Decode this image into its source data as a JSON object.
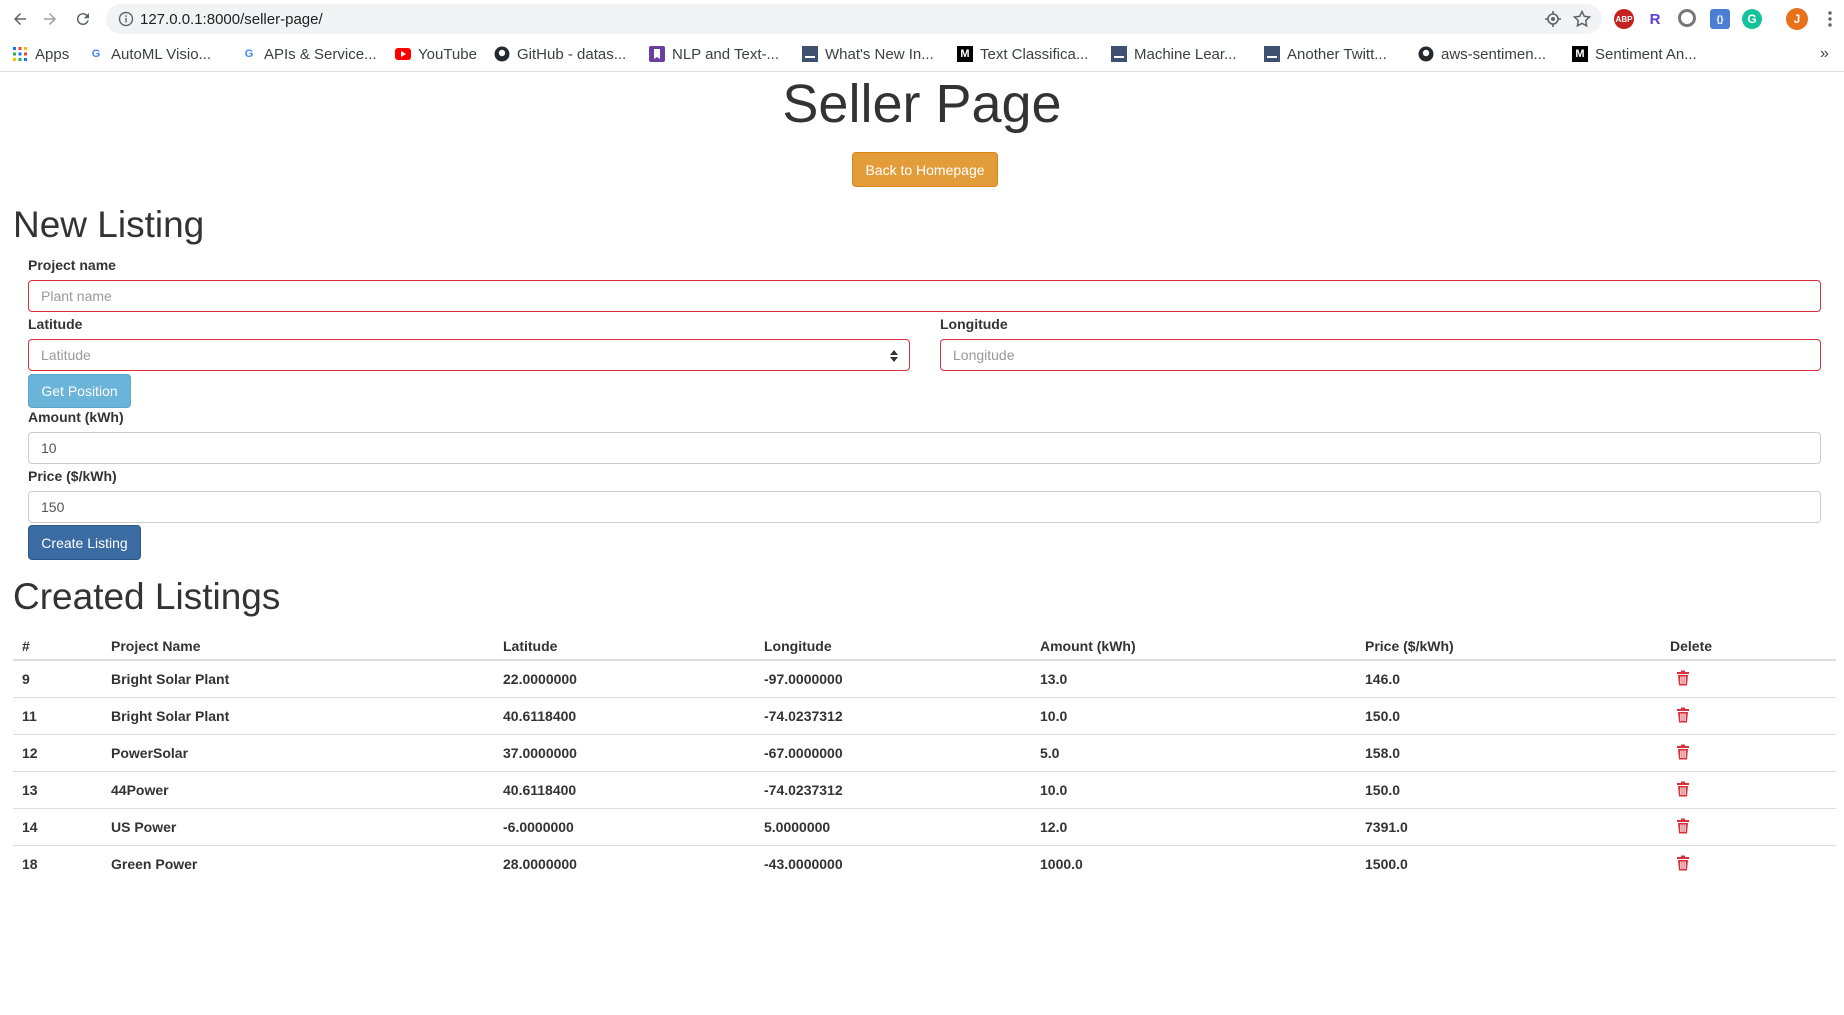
{
  "browser": {
    "url": "127.0.0.1:8000/seller-page/",
    "profile_initial": "J",
    "bookmarks": [
      {
        "label": "Apps",
        "icon": "apps-grid-icon"
      },
      {
        "label": "AutoML Visio...",
        "icon": "google-g-icon"
      },
      {
        "label": "APIs & Service...",
        "icon": "google-g-icon"
      },
      {
        "label": "YouTube",
        "icon": "youtube-icon"
      },
      {
        "label": "GitHub - datas...",
        "icon": "github-icon"
      },
      {
        "label": "NLP and Text-...",
        "icon": "bookmark-icon"
      },
      {
        "label": "What's New In...",
        "icon": "page-icon"
      },
      {
        "label": "Text Classifica...",
        "icon": "medium-icon"
      },
      {
        "label": "Machine Lear...",
        "icon": "page-icon"
      },
      {
        "label": "Another Twitt...",
        "icon": "page-icon"
      },
      {
        "label": "aws-sentimen...",
        "icon": "github-icon"
      },
      {
        "label": "Sentiment An...",
        "icon": "medium-icon"
      }
    ]
  },
  "page": {
    "title": "Seller Page",
    "back_button": "Back to Homepage"
  },
  "new_listing": {
    "heading": "New Listing",
    "project_name": {
      "label": "Project name",
      "placeholder": "Plant name",
      "value": ""
    },
    "latitude": {
      "label": "Latitude",
      "placeholder": "Latitude",
      "value": ""
    },
    "longitude": {
      "label": "Longitude",
      "placeholder": "Longitude",
      "value": ""
    },
    "get_position_button": "Get Position",
    "amount": {
      "label": "Amount (kWh)",
      "value": "10"
    },
    "price": {
      "label": "Price ($/kWh)",
      "value": "150"
    },
    "create_button": "Create Listing"
  },
  "created_listings": {
    "heading": "Created Listings",
    "columns": [
      "#",
      "Project Name",
      "Latitude",
      "Longitude",
      "Amount (kWh)",
      "Price ($/kWh)",
      "Delete"
    ],
    "rows": [
      {
        "id": "9",
        "name": "Bright Solar Plant",
        "lat": "22.0000000",
        "lon": "-97.0000000",
        "amount": "13.0",
        "price": "146.0"
      },
      {
        "id": "11",
        "name": "Bright Solar Plant",
        "lat": "40.6118400",
        "lon": "-74.0237312",
        "amount": "10.0",
        "price": "150.0"
      },
      {
        "id": "12",
        "name": "PowerSolar",
        "lat": "37.0000000",
        "lon": "-67.0000000",
        "amount": "5.0",
        "price": "158.0"
      },
      {
        "id": "13",
        "name": "44Power",
        "lat": "40.6118400",
        "lon": "-74.0237312",
        "amount": "10.0",
        "price": "150.0"
      },
      {
        "id": "14",
        "name": "US Power",
        "lat": "-6.0000000",
        "lon": "5.0000000",
        "amount": "12.0",
        "price": "7391.0"
      },
      {
        "id": "18",
        "name": "Green Power",
        "lat": "28.0000000",
        "lon": "-43.0000000",
        "amount": "1000.0",
        "price": "1500.0"
      }
    ]
  },
  "colors": {
    "back_button": "#e39c3a",
    "get_position_button": "#69b4d8",
    "create_button": "#3b6ba3",
    "invalid_border": "#d9303a",
    "delete_icon": "#d9303a"
  }
}
